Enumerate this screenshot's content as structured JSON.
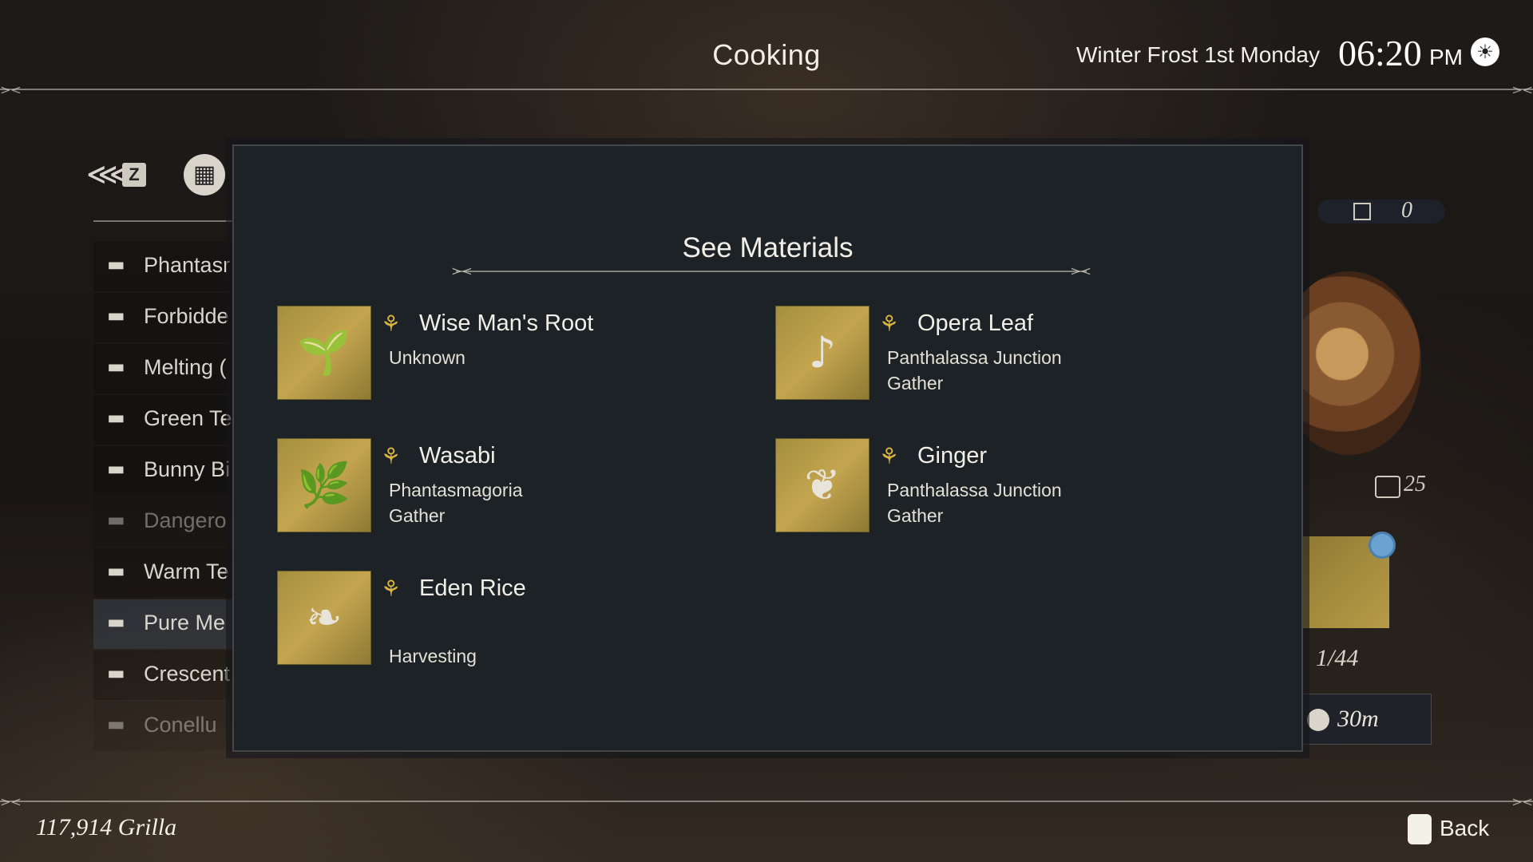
{
  "header": {
    "title": "Cooking",
    "date": "Winter Frost 1st Monday",
    "time": "06:20",
    "ampm": "PM",
    "weather_icon": "sun-icon"
  },
  "nav": {
    "back_key": "Z",
    "recipes": [
      {
        "label": "Phantasr",
        "state": "normal"
      },
      {
        "label": "Forbidde",
        "state": "normal"
      },
      {
        "label": "Melting (",
        "state": "normal"
      },
      {
        "label": "Green Te",
        "state": "normal"
      },
      {
        "label": "Bunny Bi",
        "state": "normal"
      },
      {
        "label": "Dangero",
        "state": "disabled"
      },
      {
        "label": "Warm Te",
        "state": "normal"
      },
      {
        "label": "Pure Me",
        "state": "selected"
      },
      {
        "label": "Crescent",
        "state": "normal"
      },
      {
        "label": "Conellu",
        "state": "disabled"
      }
    ]
  },
  "detail": {
    "owned": "0",
    "bubble_count": "25",
    "progress": "1/44",
    "duration": "30m"
  },
  "modal": {
    "title": "See Materials",
    "materials": [
      {
        "name": "Wise Man's Root",
        "line1": "Unknown",
        "line2": "",
        "icon": "root-icon"
      },
      {
        "name": "Opera Leaf",
        "line1": "Panthalassa Junction",
        "line2": "Gather",
        "icon": "leaf-icon"
      },
      {
        "name": "Wasabi",
        "line1": "Phantasmagoria",
        "line2": "Gather",
        "icon": "wasabi-icon"
      },
      {
        "name": "Ginger",
        "line1": "Panthalassa Junction",
        "line2": "Gather",
        "icon": "ginger-icon"
      },
      {
        "name": "Eden Rice",
        "line1": "",
        "line2": "Harvesting",
        "icon": "rice-icon"
      }
    ]
  },
  "footer": {
    "money": "117,914 Grilla",
    "back_label": "Back"
  },
  "colors": {
    "modal_bg": "#1d2227",
    "wheat_gold": "#d9b53f",
    "icon_gold": "#c4a54f"
  }
}
